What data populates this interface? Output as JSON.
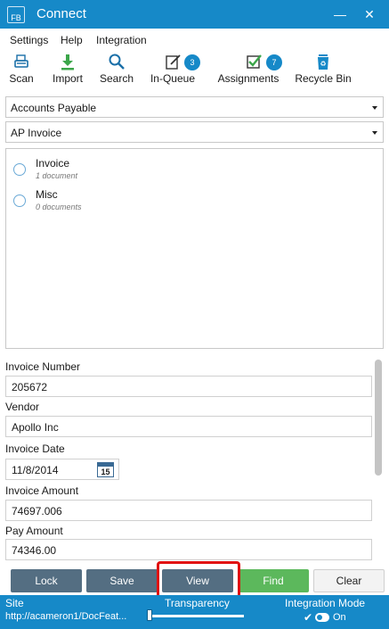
{
  "window": {
    "app_logo": "FB",
    "title": "Connect",
    "minimize_glyph": "—",
    "close_glyph": "✕"
  },
  "menu": {
    "items": [
      {
        "label": "Settings"
      },
      {
        "label": "Help"
      },
      {
        "label": "Integration"
      }
    ]
  },
  "toolbar": {
    "scan": {
      "label": "Scan",
      "icon": "scanner-icon"
    },
    "import": {
      "label": "Import",
      "icon": "download-arrow-icon"
    },
    "search": {
      "label": "Search",
      "icon": "magnifier-icon"
    },
    "inqueue": {
      "label": "In-Queue",
      "icon": "edit-document-icon",
      "badge": "3"
    },
    "assignments": {
      "label": "Assignments",
      "icon": "checkbox-icon",
      "badge": "7"
    },
    "recycle": {
      "label": "Recycle Bin",
      "icon": "recycle-bin-icon"
    }
  },
  "selects": {
    "department": "Accounts Payable",
    "document_type": "AP Invoice"
  },
  "documents": [
    {
      "name": "Invoice",
      "count": "1 document"
    },
    {
      "name": "Misc",
      "count": "0 documents"
    }
  ],
  "fields": {
    "invoice_number": {
      "label": "Invoice Number",
      "value": "205672"
    },
    "vendor": {
      "label": "Vendor",
      "value": "Apollo Inc"
    },
    "invoice_date": {
      "label": "Invoice Date",
      "value": "11/8/2014",
      "calendar_day": "15"
    },
    "invoice_amount": {
      "label": "Invoice Amount",
      "value": "74697.006"
    },
    "pay_amount": {
      "label": "Pay Amount",
      "value": "74346.00"
    }
  },
  "actions": {
    "lock": "Lock",
    "save": "Save",
    "view": "View",
    "find": "Find",
    "clear": "Clear"
  },
  "status": {
    "site_label": "Site",
    "site_value": "http://acameron1/DocFeat...",
    "transparency_label": "Transparency",
    "transparency_level": 0,
    "integration_label": "Integration Mode",
    "integration_state": "On"
  },
  "colors": {
    "accent": "#1689c8",
    "button_dark": "#546e82",
    "find_green": "#5cb85c",
    "highlight_red": "#e01010"
  }
}
